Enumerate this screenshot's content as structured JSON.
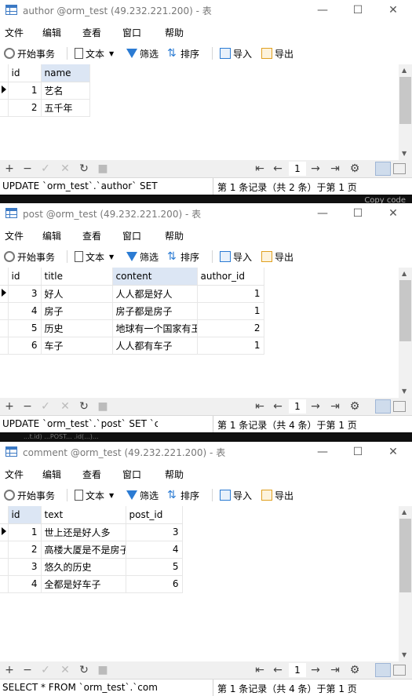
{
  "windows": [
    {
      "title": "author @orm_test (49.232.221.200) - 表",
      "menu": [
        "文件",
        "编辑",
        "查看",
        "窗口",
        "帮助"
      ],
      "toolbar": {
        "begin": "开始事务",
        "text": "文本",
        "filter": "筛选",
        "sort": "排序",
        "import": "导入",
        "export": "导出"
      },
      "columns": [
        "id",
        "name"
      ],
      "rows": [
        [
          "1",
          "艺名"
        ],
        [
          "2",
          "五千年"
        ]
      ],
      "page": "1",
      "status_left": "UPDATE `orm_test`.`author` SET `n",
      "status_right": "第 1 条记录（共 2 条）于第 1 页"
    },
    {
      "title": "post @orm_test (49.232.221.200) - 表",
      "menu": [
        "文件",
        "编辑",
        "查看",
        "窗口",
        "帮助"
      ],
      "toolbar": {
        "begin": "开始事务",
        "text": "文本",
        "filter": "筛选",
        "sort": "排序",
        "import": "导入",
        "export": "导出"
      },
      "columns": [
        "id",
        "title",
        "content",
        "author_id"
      ],
      "rows": [
        [
          "3",
          "好人",
          "人人都是好人",
          "1"
        ],
        [
          "4",
          "房子",
          "房子都是房子",
          "1"
        ],
        [
          "5",
          "历史",
          "地球有一个国家有王",
          "2"
        ],
        [
          "6",
          "车子",
          "人人都有车子",
          "1"
        ]
      ],
      "page": "1",
      "status_left": "UPDATE `orm_test`.`post` SET `cor",
      "status_right": "第 1 条记录（共 4 条）于第 1 页"
    },
    {
      "title": "comment @orm_test (49.232.221.200) - 表",
      "menu": [
        "文件",
        "编辑",
        "查看",
        "窗口",
        "帮助"
      ],
      "toolbar": {
        "begin": "开始事务",
        "text": "文本",
        "filter": "筛选",
        "sort": "排序",
        "import": "导入",
        "export": "导出"
      },
      "columns": [
        "id",
        "text",
        "post_id"
      ],
      "rows": [
        [
          "1",
          "世上还是好人多",
          "3"
        ],
        [
          "2",
          "高楼大厦是不是房子",
          "4"
        ],
        [
          "3",
          "悠久的历史",
          "5"
        ],
        [
          "4",
          "全都是好车子",
          "6"
        ]
      ],
      "page": "1",
      "status_left": "SELECT * FROM `orm_test`.`comm",
      "status_right": "第 1 条记录（共 4 条）于第 1 页"
    }
  ],
  "overlay_copy": "Copy code",
  "overlay_strip2": "...t.id)   ...POST...   .id(...)..."
}
